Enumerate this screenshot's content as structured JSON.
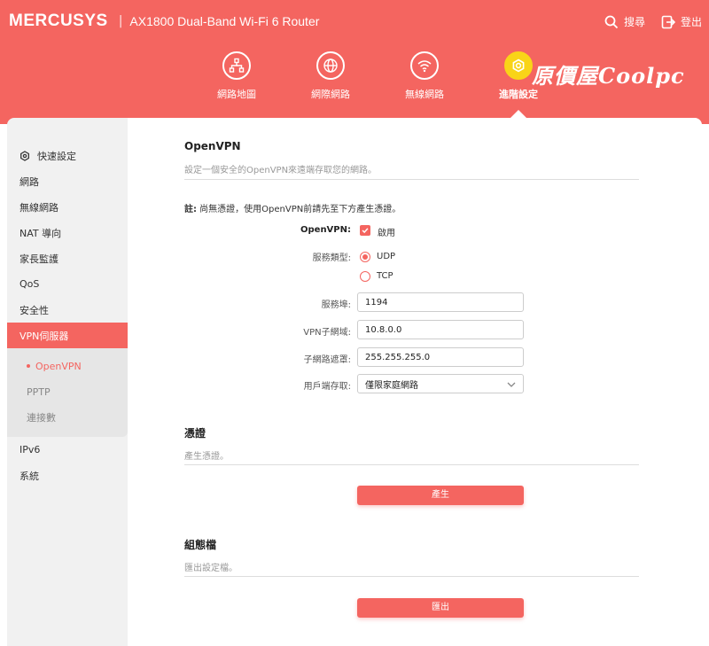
{
  "header": {
    "brand": "MERCUSYS",
    "separator": "|",
    "model": "AX1800 Dual-Band Wi-Fi 6 Router",
    "search_label": "搜尋",
    "logout_label": "登出",
    "watermark": "原價屋Coolpc"
  },
  "nav": {
    "items": [
      {
        "label": "網路地圖",
        "icon": "network-map-icon"
      },
      {
        "label": "網際網路",
        "icon": "globe-icon"
      },
      {
        "label": "無線網路",
        "icon": "wifi-icon"
      },
      {
        "label": "進階設定",
        "icon": "gear-icon"
      }
    ],
    "active": "進階設定"
  },
  "sidebar": {
    "items": [
      {
        "label": "快速設定"
      },
      {
        "label": "網路"
      },
      {
        "label": "無線網路"
      },
      {
        "label": "NAT 導向"
      },
      {
        "label": "家長監護"
      },
      {
        "label": "QoS"
      },
      {
        "label": "安全性"
      },
      {
        "label": "VPN伺服器"
      },
      {
        "label": "IPv6"
      },
      {
        "label": "系統"
      }
    ],
    "sub_items": [
      {
        "label": "OpenVPN"
      },
      {
        "label": "PPTP"
      },
      {
        "label": "連接數"
      }
    ]
  },
  "openvpn": {
    "title": "OpenVPN",
    "description": "設定一個安全的OpenVPN來遠端存取您的網路。",
    "note_prefix": "註:",
    "note_text": " 尚無憑證，使用OpenVPN前請先至下方產生憑證。",
    "enable_label": "OpenVPN:",
    "enable_value": "啟用",
    "service_type_label": "服務類型:",
    "service_options": [
      "UDP",
      "TCP"
    ],
    "service_selected": "UDP",
    "port_label": "服務埠:",
    "port_value": "1194",
    "subnet_label": "VPN子網域:",
    "subnet_value": "10.8.0.0",
    "mask_label": "子網路遮罩:",
    "mask_value": "255.255.255.0",
    "access_label": "用戶端存取:",
    "access_value": "僅限家庭網路"
  },
  "certificate": {
    "title": "憑證",
    "description": "產生憑證。",
    "button": "產生"
  },
  "config_file": {
    "title": "組態檔",
    "description": "匯出設定檔。",
    "button": "匯出"
  },
  "colors": {
    "accent": "#f46560",
    "active_nav": "#f9d418"
  }
}
